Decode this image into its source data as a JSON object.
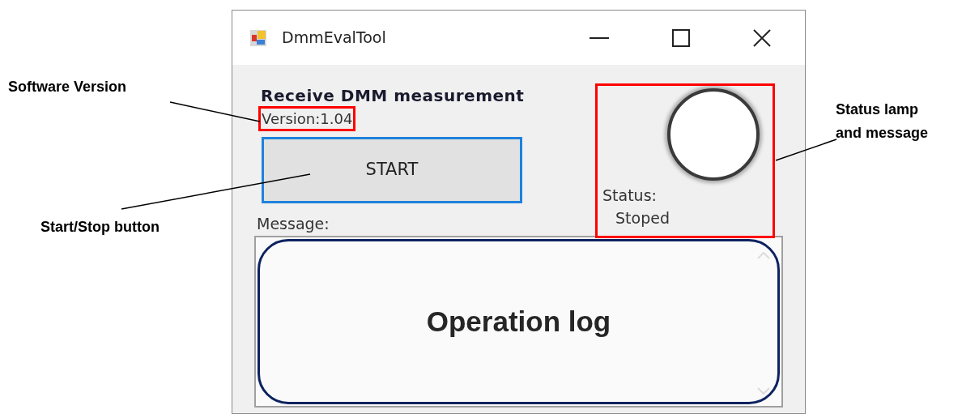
{
  "window": {
    "title": "DmmEvalTool"
  },
  "heading": "Receive DMM measurement",
  "version": "Version:1.04",
  "start_button": {
    "label": "START",
    "focused": true
  },
  "message_label": "Message:",
  "log": {
    "callout": "Operation log"
  },
  "status": {
    "label": "Status:",
    "value": "Stoped"
  },
  "annotations": [
    {
      "label": "Software Version"
    },
    {
      "label": "Start/Stop button"
    },
    {
      "label": "Status lamp and message"
    }
  ]
}
